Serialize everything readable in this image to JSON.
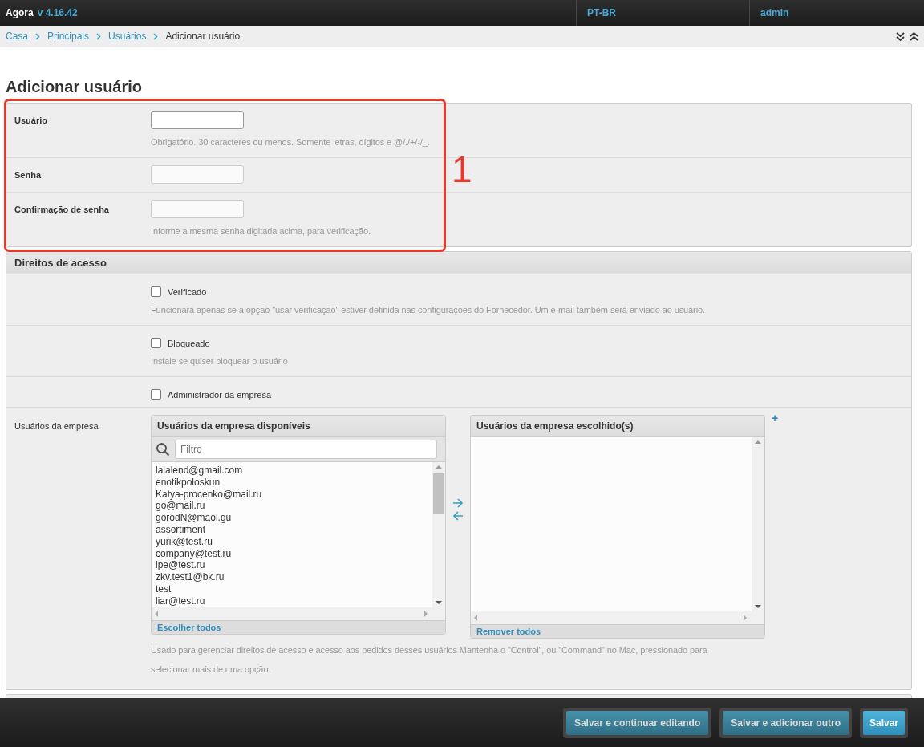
{
  "header": {
    "brand": "Agora",
    "version": "v 4.16.42",
    "language": "PT-BR",
    "user": "admin"
  },
  "breadcrumbs": [
    "Casa",
    "Principais",
    "Usuários"
  ],
  "breadcrumb_current": "Adicionar usuário",
  "page_title": "Adicionar usuário",
  "annotation": {
    "label": "1"
  },
  "credentials": [
    {
      "label": "Usuário",
      "help": "Obrigatório. 30 caracteres ou menos. Somente letras, dígitos e @/./+/-/_."
    },
    {
      "label": "Senha"
    },
    {
      "label": "Confirmação de senha",
      "help": "Informe a mesma senha digitada acima, para verificação."
    }
  ],
  "access": {
    "title": "Direitos de acesso",
    "options": [
      {
        "label": "Verificado",
        "checked": false,
        "help": "Funcionará apenas se a opção \"usar verificação\" estiver definida nas configurações do Fornecedor. Um e-mail também será enviado ao usuário."
      },
      {
        "label": "Bloqueado",
        "checked": false,
        "help": "Instale se quiser bloquear o usuário"
      },
      {
        "label": "Administrador da empresa",
        "checked": false
      }
    ],
    "company_users": {
      "label": "Usuários da empresa",
      "available_title": "Usuários da empresa disponíveis",
      "filter_placeholder": "Filtro",
      "available": [
        {
          "text": "lalalend@gmail.com",
          "selected": false
        },
        {
          "text": "enotikpoloskun",
          "selected": false
        },
        {
          "text": "Katya-procenko@mail.ru",
          "selected": false
        },
        {
          "text": "go@mail.ru",
          "selected": false
        },
        {
          "text": "gorodN@maol.gu",
          "selected": false
        },
        {
          "text": "assortiment",
          "selected": false
        },
        {
          "text": "yurik@test.ru",
          "selected": false
        },
        {
          "text": "company@test.ru",
          "selected": false
        },
        {
          "text": "ipe@test.ru",
          "selected": false
        },
        {
          "text": "zkv.test1@bk.ru",
          "selected": false
        },
        {
          "text": "test",
          "selected": false
        },
        {
          "text": "liar@test.ru",
          "selected": false
        }
      ],
      "choose_all": "Escolher todos",
      "chosen_title": "Usuários da empresa escolhido(s)",
      "remove_all": "Remover todos",
      "add": "+",
      "help": "Usado para gerenciar direitos de acesso e acesso aos pedidos desses usuários Mantenha o \"Control\", ou \"Command\" no Mac, pressionado para selecionar mais de uma opção."
    }
  },
  "actions": [
    {
      "label": "Salvar e continuar editando",
      "kind": "secondary"
    },
    {
      "label": "Salvar e adicionar outro",
      "kind": "secondary"
    },
    {
      "label": "Salvar",
      "kind": "primary"
    }
  ]
}
